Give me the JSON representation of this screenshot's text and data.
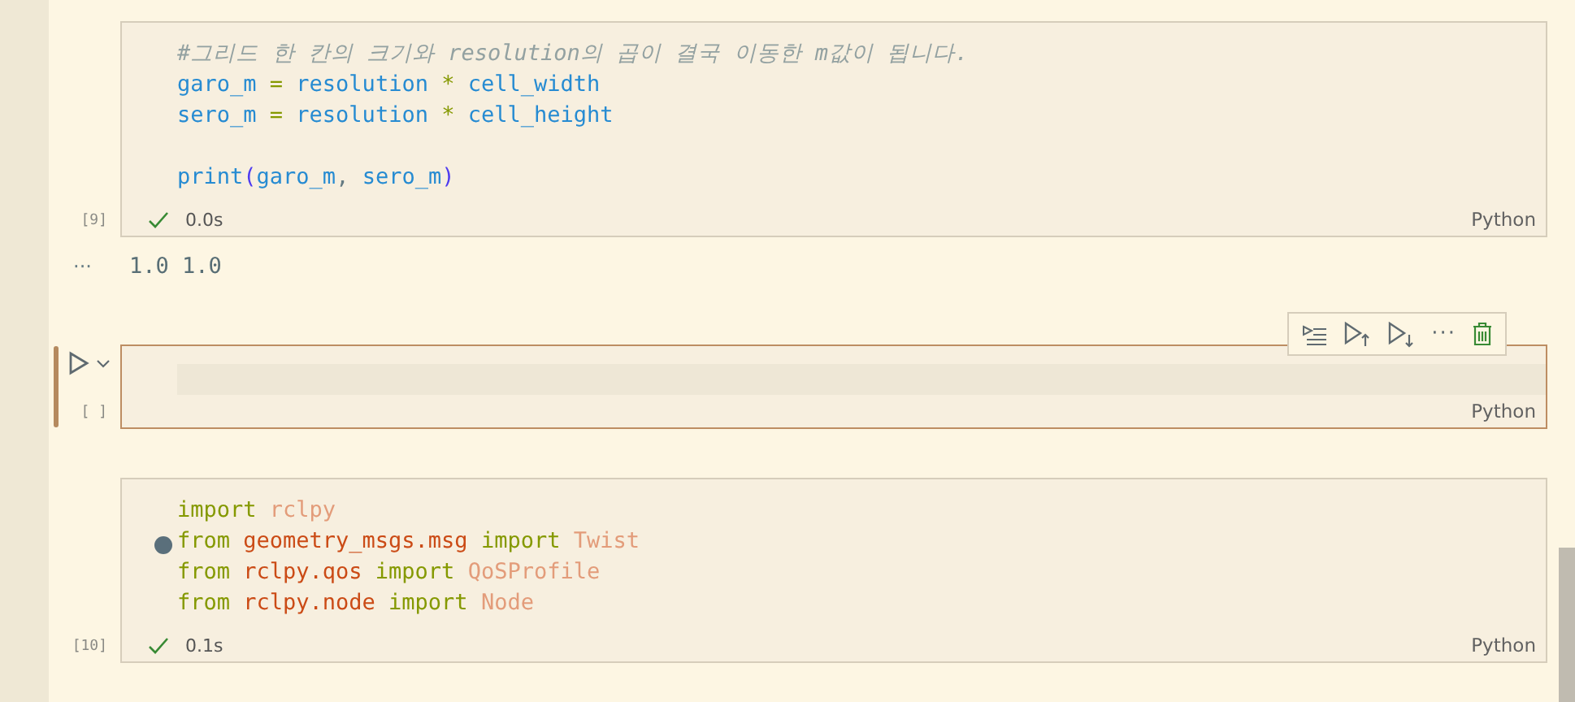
{
  "cells": [
    {
      "kind": "code",
      "focused": false,
      "count": "[9]",
      "succeeded": true,
      "time": "0.0s",
      "language": "Python",
      "lines": [
        {
          "kind": "code",
          "tokens": [
            {
              "kind": "comment",
              "s": "#그리드 한 칸의 크기와 resolution의 곱이 결국 이동한 m값이 됩니다."
            }
          ]
        },
        {
          "kind": "code",
          "tokens": [
            {
              "kind": "var",
              "s": "garo_m"
            },
            {
              "kind": "op",
              "s": " = "
            },
            {
              "kind": "var",
              "s": "resolution"
            },
            {
              "kind": "op",
              "s": " * "
            },
            {
              "kind": "var",
              "s": "cell_width"
            }
          ]
        },
        {
          "kind": "code",
          "tokens": [
            {
              "kind": "var",
              "s": "sero_m"
            },
            {
              "kind": "op",
              "s": " = "
            },
            {
              "kind": "var",
              "s": "resolution"
            },
            {
              "kind": "op",
              "s": " * "
            },
            {
              "kind": "var",
              "s": "cell_height"
            }
          ]
        },
        {
          "kind": "blank"
        },
        {
          "kind": "code",
          "tokens": [
            {
              "kind": "var",
              "s": "print"
            },
            {
              "kind": "paren",
              "s": "("
            },
            {
              "kind": "var",
              "s": "garo_m"
            },
            {
              "kind": "plain",
              "s": ", "
            },
            {
              "kind": "var",
              "s": "sero_m"
            },
            {
              "kind": "paren",
              "s": ")"
            }
          ]
        }
      ],
      "output": {
        "marker": "···",
        "text": "1.0 1.0"
      }
    },
    {
      "kind": "empty",
      "focused": true,
      "count": "[ ]",
      "language": "Python",
      "toolbar": [
        {
          "kind": "run_by_line"
        },
        {
          "kind": "run_above"
        },
        {
          "kind": "run_below"
        },
        {
          "kind": "more"
        },
        {
          "kind": "delete"
        }
      ],
      "more_label": "···"
    },
    {
      "kind": "code",
      "focused": false,
      "count": "[10]",
      "succeeded": true,
      "time": "0.1s",
      "language": "Python",
      "cursor_dot": true,
      "lines": [
        {
          "kind": "code",
          "tokens": [
            {
              "kind": "keyword",
              "s": "import "
            },
            {
              "kind": "name",
              "s": "rclpy"
            }
          ]
        },
        {
          "kind": "code",
          "tokens": [
            {
              "kind": "keyword",
              "s": "from "
            },
            {
              "kind": "module",
              "s": "geometry_msgs.msg "
            },
            {
              "kind": "keyword",
              "s": "import "
            },
            {
              "kind": "name",
              "s": "Twist"
            }
          ]
        },
        {
          "kind": "code",
          "tokens": [
            {
              "kind": "keyword",
              "s": "from "
            },
            {
              "kind": "module",
              "s": "rclpy.qos "
            },
            {
              "kind": "keyword",
              "s": "import "
            },
            {
              "kind": "name",
              "s": "QoSProfile"
            }
          ]
        },
        {
          "kind": "code",
          "tokens": [
            {
              "kind": "keyword",
              "s": "from "
            },
            {
              "kind": "module",
              "s": "rclpy.node "
            },
            {
              "kind": "keyword",
              "s": "import "
            },
            {
              "kind": "name",
              "s": "Node"
            }
          ]
        }
      ]
    }
  ]
}
